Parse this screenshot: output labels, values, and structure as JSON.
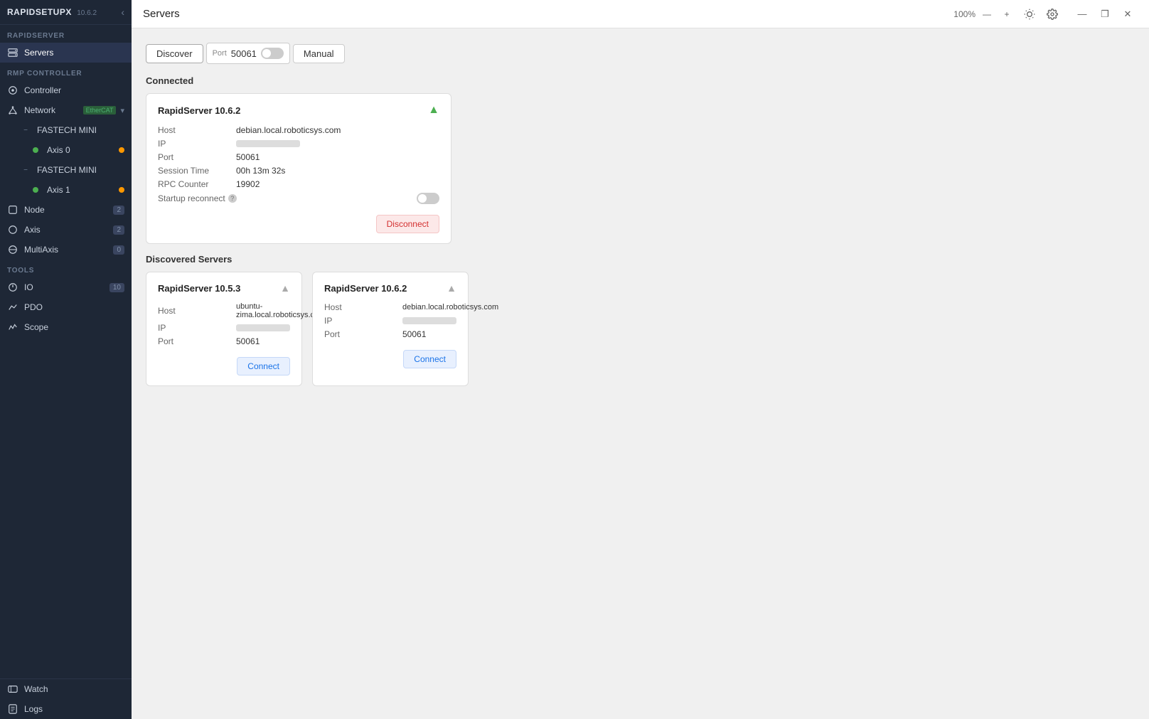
{
  "app": {
    "title": "RAPIDSETUPX",
    "version": "10.6.2",
    "collapse_btn": "‹"
  },
  "sidebar": {
    "rapidserver_section": "RAPIDSERVER",
    "rmp_controller_section": "RMP CONTROLLER",
    "tools_section": "ToOls",
    "bottom_section": "",
    "items": {
      "servers": "Servers",
      "controller": "Controller",
      "network": "Network",
      "network_badge": "EtherCAT",
      "fastech_mini_1": "FASTECH MINI",
      "axis_0": "Axis 0",
      "fastech_mini_2": "FASTECH MINI",
      "axis_1": "Axis 1",
      "node": "Node",
      "node_count": "2",
      "axis": "Axis",
      "axis_count": "2",
      "multiaxis": "MultiAxis",
      "multiaxis_count": "0",
      "io": "IO",
      "io_count": "10",
      "pdo": "PDO",
      "scope": "Scope",
      "watch": "Watch",
      "logs": "Logs"
    }
  },
  "main": {
    "title": "Servers",
    "zoom": "100%",
    "tabs": {
      "discover": "Discover",
      "port_label": "Port",
      "port_value": "50061",
      "manual": "Manual"
    },
    "connected_section": "Connected",
    "connected_card": {
      "title": "RapidServer 10.6.2",
      "host_label": "Host",
      "host_value": "debian.local.roboticsys.com",
      "ip_label": "IP",
      "port_label": "Port",
      "port_value": "50061",
      "session_time_label": "Session Time",
      "session_time_value": "00h 13m 32s",
      "rpc_counter_label": "RPC Counter",
      "rpc_counter_value": "19902",
      "startup_reconnect_label": "Startup reconnect",
      "disconnect_btn": "Disconnect"
    },
    "discovered_section": "Discovered Servers",
    "discovered_cards": [
      {
        "title": "RapidServer 10.5.3",
        "host_label": "Host",
        "host_value": "ubuntu-zima.local.roboticsys.com",
        "ip_label": "IP",
        "port_label": "Port",
        "port_value": "50061",
        "connect_btn": "Connect"
      },
      {
        "title": "RapidServer 10.6.2",
        "host_label": "Host",
        "host_value": "debian.local.roboticsys.com",
        "ip_label": "IP",
        "port_label": "Port",
        "port_value": "50061",
        "connect_btn": "Connect"
      }
    ]
  },
  "titlebar": {
    "zoom": "100%",
    "minus": "—",
    "plus": "+",
    "minimize": "—",
    "maximize": "❐",
    "close": "✕"
  }
}
